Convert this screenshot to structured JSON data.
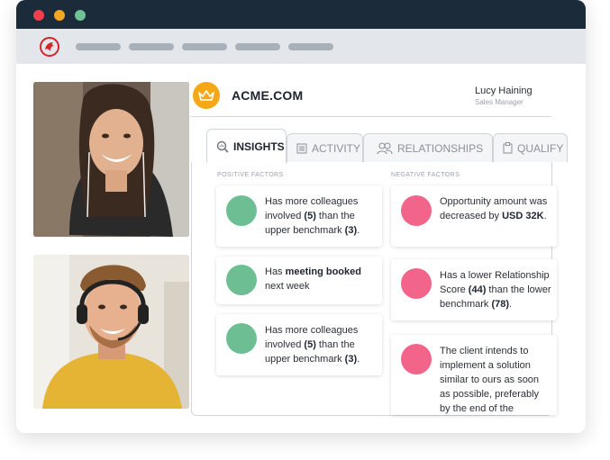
{
  "window": {
    "traffic_lights": [
      "#ee3f4d",
      "#f5a623",
      "#6fc196"
    ],
    "logo": "crm-logo-icon"
  },
  "account": {
    "name": "ACME.COM",
    "logo_icon": "crown-icon",
    "logo_color": "#f5a816"
  },
  "user": {
    "name": "Lucy Haining",
    "role": "Sales Manager"
  },
  "tabs": [
    {
      "label": "INSIGHTS",
      "icon": "search-insights-icon",
      "active": true
    },
    {
      "label": "ACTIVITY",
      "icon": "list-icon",
      "active": false
    },
    {
      "label": "RELATIONSHIPS",
      "icon": "people-icon",
      "active": false
    },
    {
      "label": "QUALIFY",
      "icon": "clipboard-icon",
      "active": false
    }
  ],
  "positive": {
    "title": "POSITIVE FACTORS",
    "color": "#6dbf93",
    "items": [
      {
        "pre": "Has more colleagues involved ",
        "b1": "(5)",
        "mid": " than the upper benchmark ",
        "b2": "(3)",
        "post": "."
      },
      {
        "pre": "Has ",
        "b1": "meeting booked",
        "mid": " next week",
        "b2": "",
        "post": ""
      },
      {
        "pre": "Has more colleagues involved ",
        "b1": "(5)",
        "mid": " than the upper benchmark ",
        "b2": "(3)",
        "post": "."
      }
    ]
  },
  "negative": {
    "title": "NEGATIVE FACTORS",
    "color": "#f3648a",
    "items": [
      {
        "pre": "Opportunity amount was decreased by ",
        "b1": "USD 32K",
        "mid": ".",
        "b2": "",
        "post": ""
      },
      {
        "pre": "Has a lower Relationship Score ",
        "b1": "(44)",
        "mid": " than the lower benchmark ",
        "b2": "(78)",
        "post": "."
      },
      {
        "pre": "The client intends to implement a solution similar to ours as soon as possible, preferably by the end of the",
        "b1": "",
        "mid": "",
        "b2": "",
        "post": ""
      }
    ]
  },
  "videos": [
    {
      "label": "video-participant-woman"
    },
    {
      "label": "video-participant-man-headset"
    }
  ]
}
